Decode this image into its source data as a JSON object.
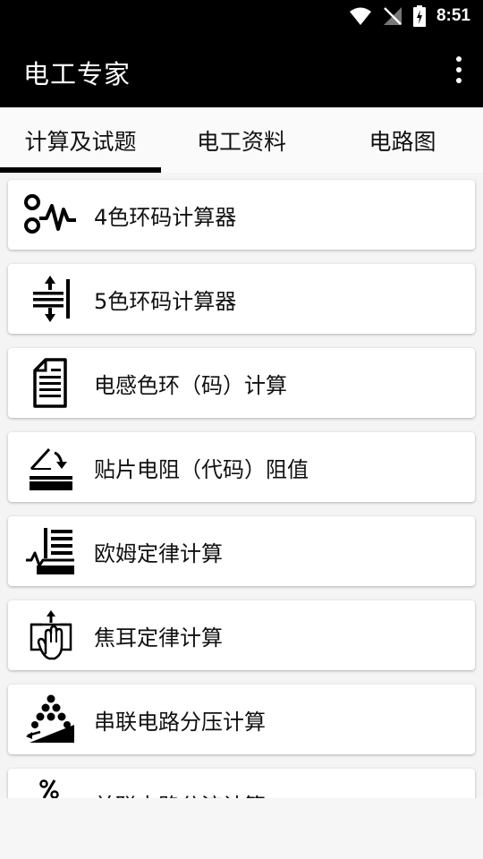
{
  "status": {
    "time": "8:51"
  },
  "app": {
    "title": "电工专家"
  },
  "tabs": [
    {
      "label": "计算及试题",
      "active": true
    },
    {
      "label": "电工资料",
      "active": false
    },
    {
      "label": "电路图",
      "active": false
    }
  ],
  "items": [
    {
      "label": "4色环码计算器",
      "icon": "resistor-wave-icon"
    },
    {
      "label": "5色环码计算器",
      "icon": "spacing-arrows-icon"
    },
    {
      "label": "电感色环（码）计算",
      "icon": "document-icon"
    },
    {
      "label": "贴片电阻（代码）阻值",
      "icon": "chip-resistor-icon"
    },
    {
      "label": "欧姆定律计算",
      "icon": "ohm-law-icon"
    },
    {
      "label": "焦耳定律计算",
      "icon": "hand-touch-icon"
    },
    {
      "label": "串联电路分压计算",
      "icon": "balls-ramp-icon"
    },
    {
      "label": "并联电路分流计算",
      "icon": "percent-icon"
    }
  ]
}
